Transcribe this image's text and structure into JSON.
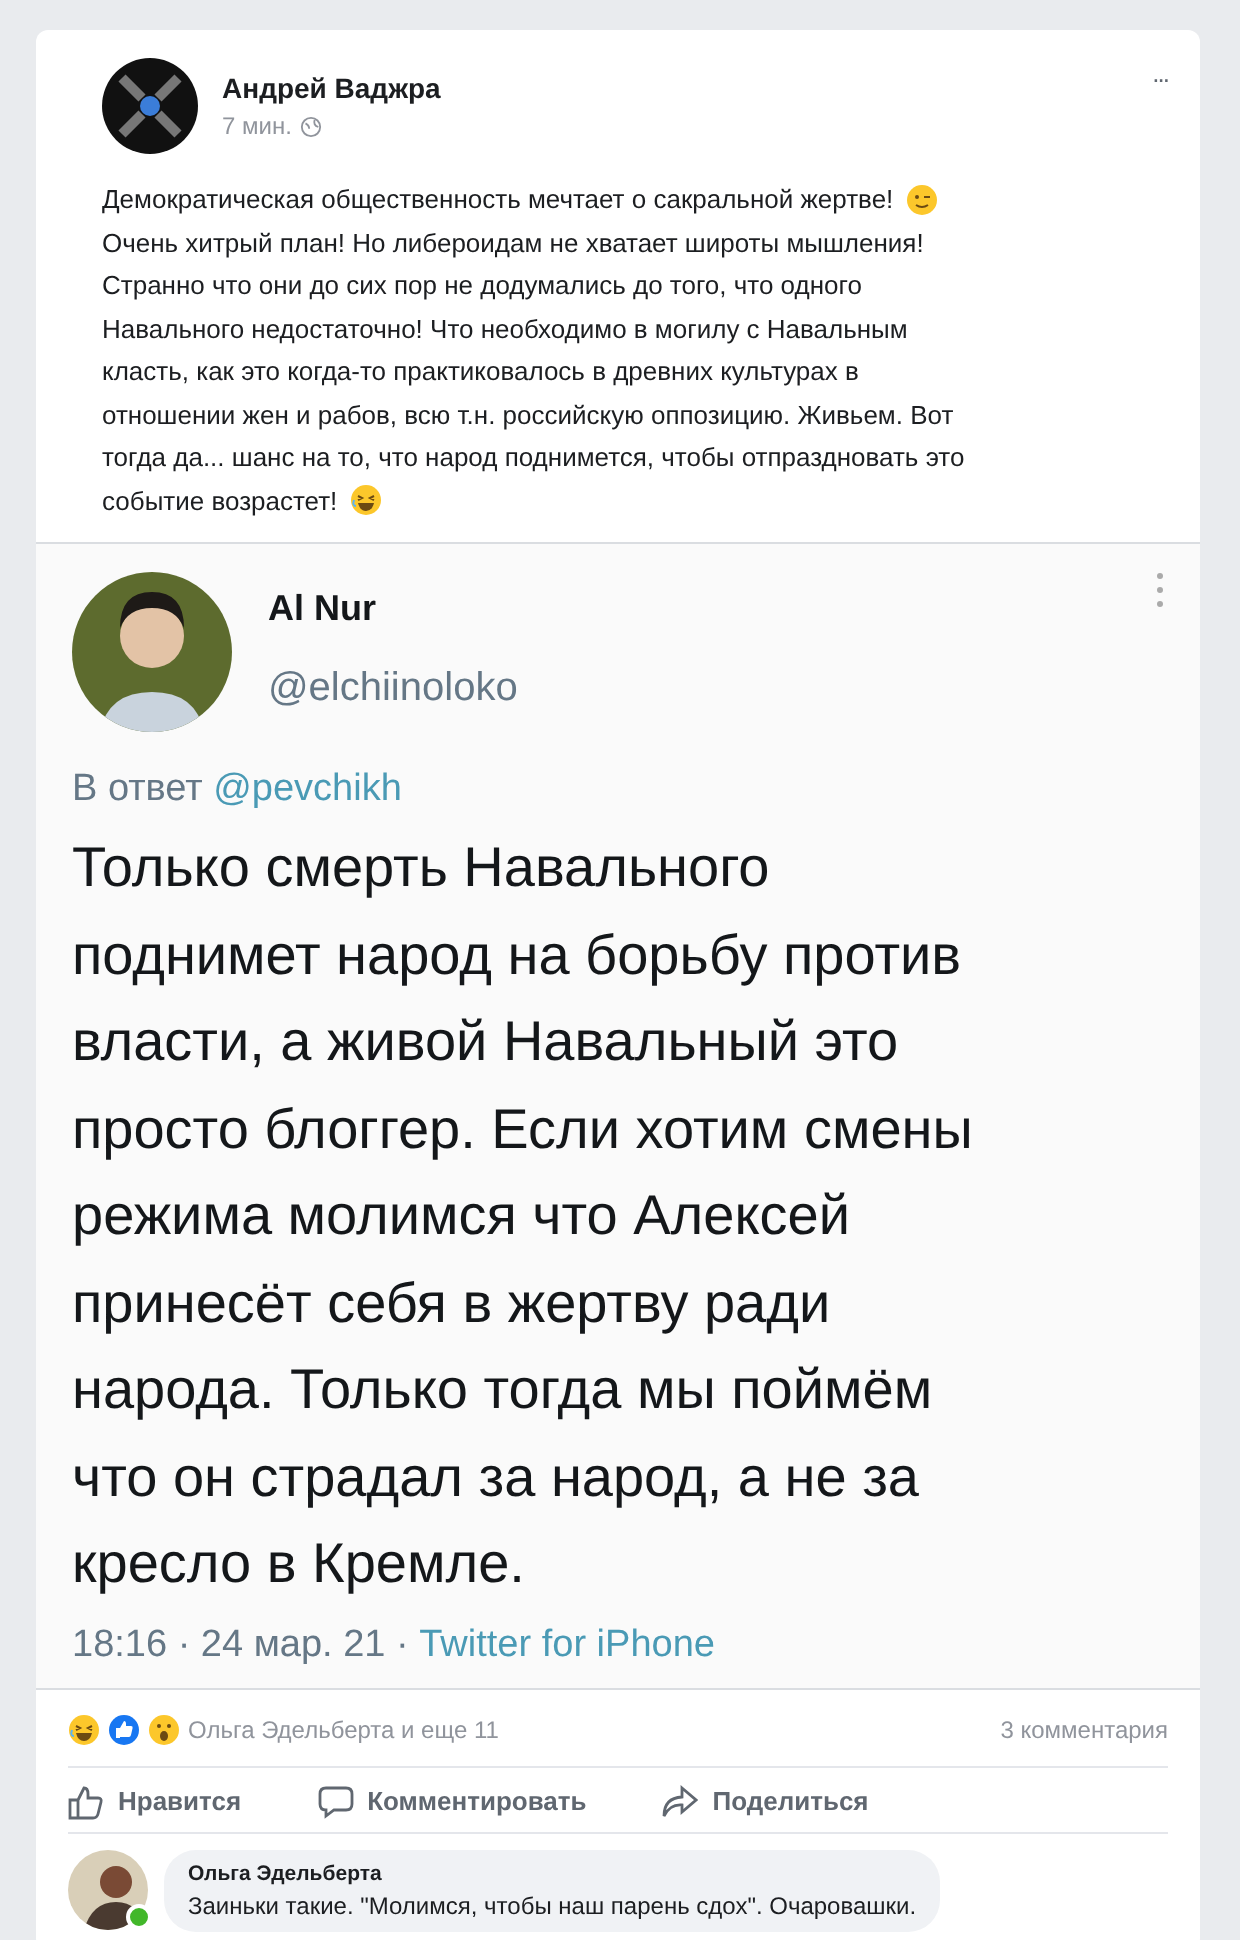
{
  "post": {
    "author": "Андрей Ваджра",
    "time": "7 мин.",
    "menu": "...",
    "text_lines": [
      "Демократическая общественность мечтает о сакральной жертве!",
      "Очень хитрый план! Но либероидам не хватает широты мышления!",
      "Странно что они до сих пор не додумались до того, что одного",
      "Навального недостаточно! Что необходимо в могилу с Навальным",
      "класть, как это когда-то практиковалось в древних культурах в",
      "отношении жен и рабов, всю т.н. российскую оппозицию. Живьем. Вот",
      "тогда да... шанс на то, что народ поднимется, чтобы отпраздновать это",
      "событие возрастет!"
    ]
  },
  "tweet": {
    "name": "Al Nur",
    "handle": "@elchiinoloko",
    "reply_prefix": "В ответ",
    "reply_to": "@pevchikh",
    "text": "Только смерть Навального\nподнимет народ на борьбу против\nвласти, а живой Навальный это\nпросто блоггер. Если хотим смены\nрежима молимся что Алексей\nпринесёт себя в жертву ради\nнарода. Только тогда мы поймём\nчто он страдал за народ, а не за\nкресло в Кремле.",
    "meta": "18:16 · 24 мар. 21 ·",
    "source": "Twitter for iPhone"
  },
  "reactions": {
    "summary": "Ольга Эдельберта и еще 11",
    "comments": "3 комментария"
  },
  "actions": [
    "Нравится",
    "Комментировать",
    "Поделиться"
  ],
  "comment": {
    "author": "Ольга Эдельберта",
    "text": "Заиньки такие. \"Молимся, чтобы наш парень сдох\". Очаровашки.",
    "online": true
  }
}
